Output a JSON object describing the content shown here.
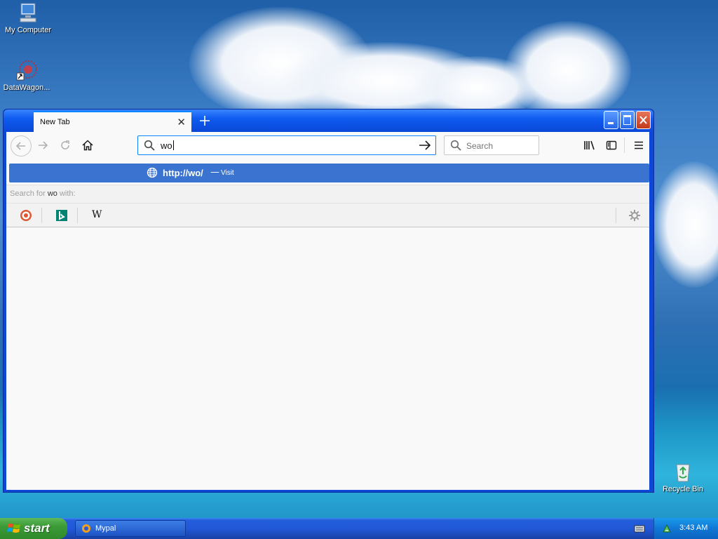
{
  "desktop": {
    "icons": [
      {
        "label": "My Computer"
      },
      {
        "label": "DataWagon..."
      },
      {
        "label": "Recycle Bin"
      }
    ]
  },
  "browser": {
    "tab_title": "New Tab",
    "url_value": "wo",
    "search_placeholder": "Search",
    "suggestion": {
      "url": "http://wo/",
      "separator": "—",
      "action": "Visit"
    },
    "search_with": {
      "prefix": "Search for ",
      "term": "wo",
      "suffix": " with:"
    },
    "engines": [
      "DuckDuckGo",
      "Bing",
      "Wikipedia"
    ],
    "wikipedia_glyph": "W"
  },
  "taskbar": {
    "start_label": "start",
    "task_label": "Mypal",
    "clock": "3:43 AM"
  },
  "colors": {
    "accent": "#0a84ff",
    "suggestion_bg": "#3b74d0",
    "xp_blue": "#0c47d6",
    "start_green": "#3c9a37"
  }
}
